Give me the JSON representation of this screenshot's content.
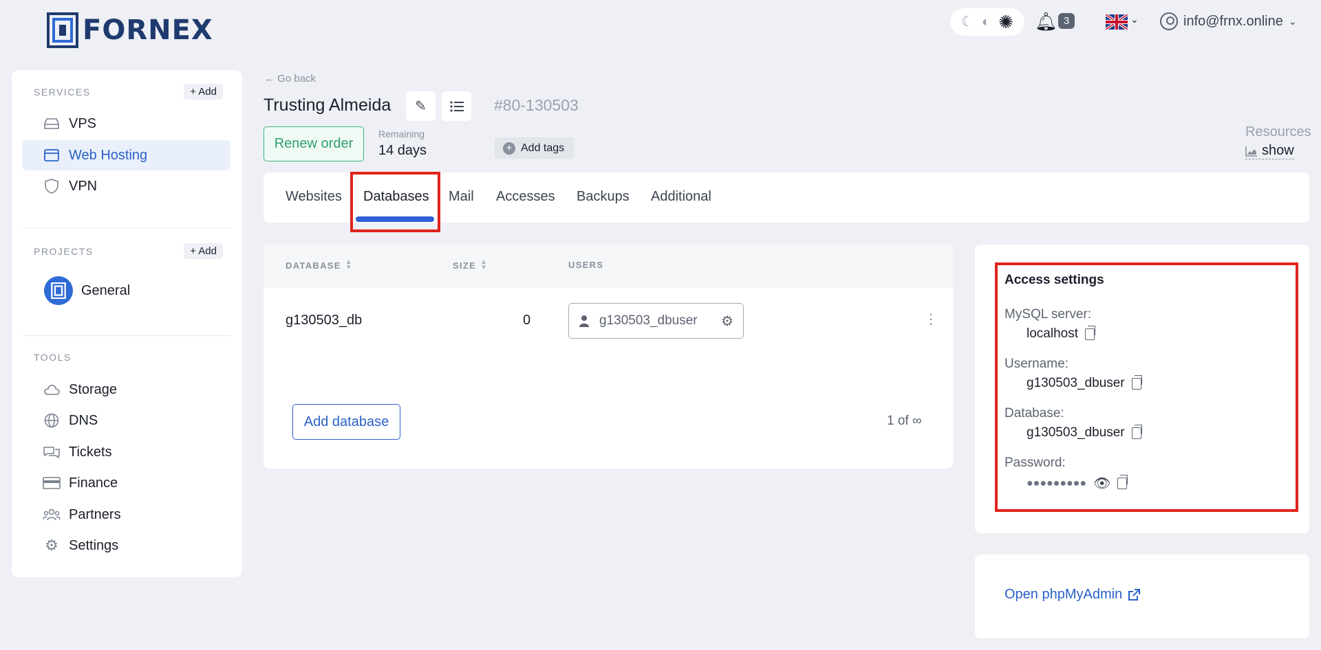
{
  "brand": {
    "name": "FORNEX"
  },
  "header": {
    "notifications_count": "3",
    "user_email": "info@frnx.online",
    "theme": {
      "moon": "☾",
      "auto": "◐",
      "sun": "✺"
    }
  },
  "sidebar": {
    "services_title": "SERVICES",
    "services_add": "+ Add",
    "services": [
      {
        "label": "VPS",
        "icon": "server-icon"
      },
      {
        "label": "Web Hosting",
        "icon": "browser-icon",
        "active": true
      },
      {
        "label": "VPN",
        "icon": "shield-icon"
      }
    ],
    "projects_title": "PROJECTS",
    "projects_add": "+ Add",
    "projects": [
      {
        "label": "General"
      }
    ],
    "tools_title": "TOOLS",
    "tools": [
      {
        "label": "Storage",
        "icon": "cloud-icon"
      },
      {
        "label": "DNS",
        "icon": "globe-icon"
      },
      {
        "label": "Tickets",
        "icon": "chat-icon"
      },
      {
        "label": "Finance",
        "icon": "card-icon"
      },
      {
        "label": "Partners",
        "icon": "users-icon"
      },
      {
        "label": "Settings",
        "icon": "gear-icon"
      }
    ]
  },
  "page": {
    "go_back": "Go back",
    "title": "Trusting Almeida",
    "order_id": "80-130503",
    "renew_label": "Renew order",
    "remaining_label": "Remaining",
    "remaining_value": "14 days",
    "add_tags": "Add tags",
    "resources_label": "Resources",
    "resources_link": "show"
  },
  "tabs": [
    "Websites",
    "Databases",
    "Mail",
    "Accesses",
    "Backups",
    "Additional"
  ],
  "active_tab": "Databases",
  "databases": {
    "columns": [
      "DATABASE",
      "SIZE",
      "USERS"
    ],
    "rows": [
      {
        "name": "g130503_db",
        "size": "0",
        "user": "g130503_dbuser"
      }
    ],
    "add_label": "Add database",
    "pager": "1 of ∞"
  },
  "access": {
    "title": "Access settings",
    "mysql_label": "MySQL server:",
    "mysql_value": "localhost",
    "username_label": "Username:",
    "username_value": "g130503_dbuser",
    "database_label": "Database:",
    "database_value": "g130503_dbuser",
    "password_label": "Password:",
    "password_value": "●●●●●●●●●"
  },
  "phpmyadmin": {
    "label": "Open phpMyAdmin"
  },
  "colors": {
    "accent": "#2a60c8",
    "renew": "#2f9e6d",
    "highlight": "#e0231c"
  }
}
